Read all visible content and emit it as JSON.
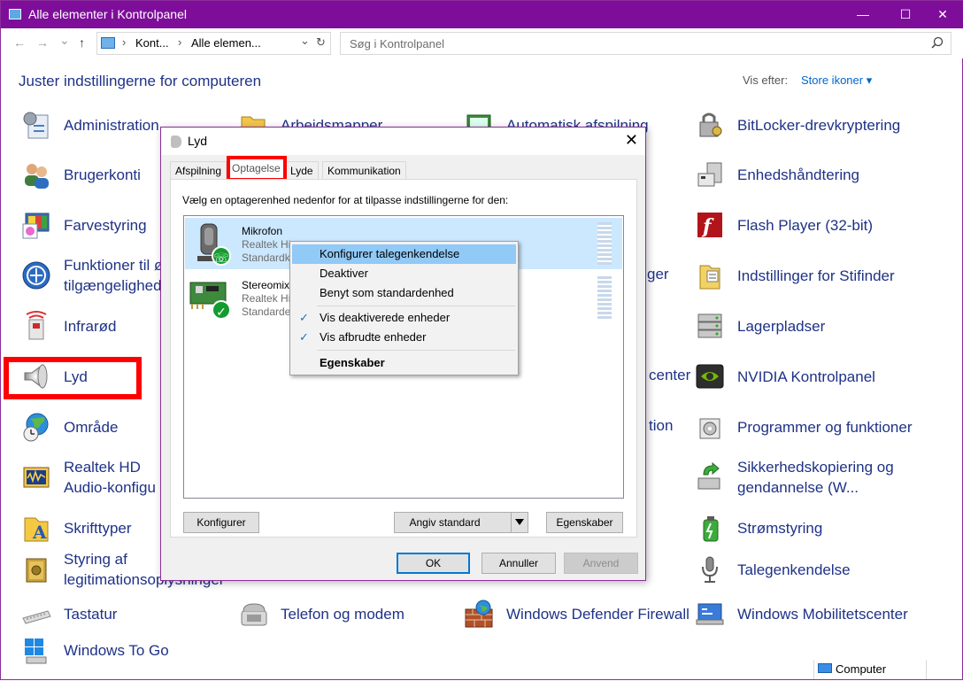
{
  "window": {
    "title": "Alle elementer i Kontrolpanel",
    "minimize": "—",
    "maximize": "☐",
    "close": "✕"
  },
  "address": {
    "back": "←",
    "forward": "→",
    "history": "⌄",
    "up": "↑",
    "crumb1": "Kont...",
    "crumb2": "Alle elemen...",
    "sep": "›",
    "dropdown": "⌄",
    "refresh": "↻",
    "search_placeholder": "Søg i Kontrolpanel"
  },
  "header": {
    "title": "Juster indstillingerne for computeren",
    "view_by_label": "Vis efter:",
    "view_by_value": "Store ikoner ▾"
  },
  "items": {
    "c1": [
      {
        "label": "Administration",
        "icon": "administration-icon"
      },
      {
        "label": "Brugerkonti",
        "icon": "user-accounts-icon"
      },
      {
        "label": "Farvestyring",
        "icon": "color-management-icon"
      },
      {
        "label": "Funktioner til øget tilgængelighed",
        "line1": "Funktioner til ø",
        "line2": "tilgængelighed",
        "icon": "ease-of-access-icon"
      },
      {
        "label": "Infrarød",
        "icon": "infrared-icon"
      },
      {
        "label": "Lyd",
        "icon": "speaker-icon"
      },
      {
        "label": "Område",
        "icon": "region-icon"
      },
      {
        "label": "Realtek HD Audio-konfiguration",
        "line1": "Realtek HD",
        "line2": "Audio-konfigu",
        "icon": "realtek-icon"
      },
      {
        "label": "Skrifttyper",
        "icon": "fonts-icon"
      },
      {
        "label": "Styring af legitimationsoplysninger",
        "line1": "Styring af",
        "line2": "legitimationsoplysninger",
        "icon": "credential-manager-icon"
      },
      {
        "label": "Tastatur",
        "icon": "keyboard-icon"
      },
      {
        "label": "Windows To Go",
        "icon": "windows-to-go-icon"
      }
    ],
    "c2": [
      {
        "label": "Arbejdsmapper",
        "icon": "work-folders-icon"
      },
      {
        "label": "Telefon og modem",
        "icon": "phone-modem-icon"
      }
    ],
    "c3": [
      {
        "label": "Automatisk afspilning",
        "icon": "autoplay-icon"
      },
      {
        "label": "Windows Defender Firewall",
        "icon": "firewall-icon"
      }
    ],
    "c3_partial": [
      "ger",
      "center",
      "tion"
    ],
    "c4": [
      {
        "label": "BitLocker-drevkryptering",
        "icon": "bitlocker-icon"
      },
      {
        "label": "Enhedshåndtering",
        "icon": "device-manager-icon"
      },
      {
        "label": "Flash Player (32-bit)",
        "icon": "flash-player-icon"
      },
      {
        "label": "Indstillinger for Stifinder",
        "icon": "file-explorer-options-icon"
      },
      {
        "label": "Lagerpladser",
        "icon": "storage-spaces-icon"
      },
      {
        "label": "NVIDIA Kontrolpanel",
        "icon": "nvidia-icon"
      },
      {
        "label": "Programmer og funktioner",
        "icon": "programs-features-icon"
      },
      {
        "label": "Sikkerhedskopiering og gendannelse (Windows 7)",
        "line1": "Sikkerhedskopiering og",
        "line2": "gendannelse (W...",
        "icon": "backup-restore-icon"
      },
      {
        "label": "Strømstyring",
        "icon": "power-options-icon"
      },
      {
        "label": "Talegenkendelse",
        "icon": "microphone-icon"
      },
      {
        "label": "Windows Mobilitetscenter",
        "icon": "mobility-center-icon"
      }
    ]
  },
  "status": {
    "computer": "Computer"
  },
  "dialog": {
    "title": "Lyd",
    "close": "✕",
    "tabs": [
      "Afspilning",
      "Optagelse",
      "Lyde",
      "Kommunikation"
    ],
    "active_tab": "Optagelse",
    "instruction": "Vælg en optagerenhed nedenfor for at tilpasse indstillingerne for den:",
    "devices": [
      {
        "name": "Mikrofon",
        "sub1": "Realtek High Definition Audio",
        "sub1_visible": "Realtek Hi",
        "sub2_visible": "Standardk",
        "status": "default",
        "badge": "phone-badge-icon"
      },
      {
        "name": "Stereomix",
        "sub1_visible": "Realtek Hi",
        "sub2_visible": "Standarde",
        "status": "default",
        "badge": "check-badge-icon"
      }
    ],
    "buttons": {
      "configure": "Konfigurer",
      "set_default": "Angiv standard",
      "properties": "Egenskaber",
      "ok": "OK",
      "cancel": "Annuller",
      "apply": "Anvend"
    }
  },
  "context_menu": {
    "items": [
      {
        "label": "Konfigurer talegenkendelse",
        "checked": false,
        "bold": false
      },
      {
        "label": "Deaktiver",
        "checked": false,
        "bold": false
      },
      {
        "label": "Benyt som standardenhed",
        "checked": false,
        "bold": false
      },
      {
        "label": "Vis deaktiverede enheder",
        "checked": true,
        "bold": false
      },
      {
        "label": "Vis afbrudte enheder",
        "checked": true,
        "bold": false
      },
      {
        "label": "Egenskaber",
        "checked": false,
        "bold": true
      }
    ],
    "check": "✓"
  },
  "colors": {
    "title_bar": "#7e0e9a",
    "link_text": "#1e3287",
    "highlight": "#ff0000",
    "selection": "#cce8ff"
  }
}
